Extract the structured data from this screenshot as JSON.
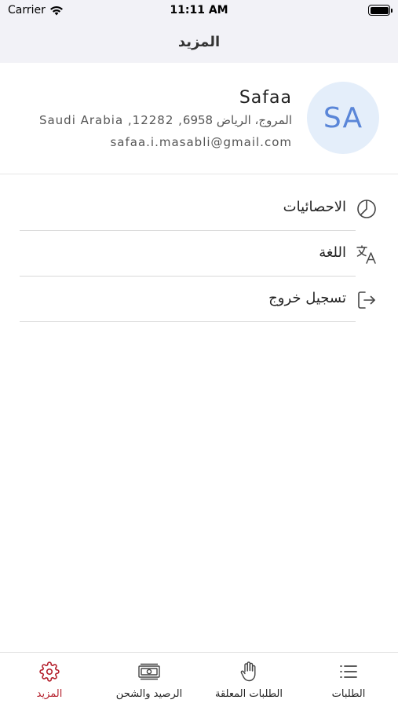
{
  "status_bar": {
    "carrier": "Carrier",
    "time": "11:11 AM"
  },
  "nav": {
    "title": "المزيد"
  },
  "profile": {
    "initials": "SA",
    "name": "Safaa",
    "address": "Saudi Arabia ,12282 ,المروج، الرياض 6958",
    "email": "safaa.i.masabli@gmail.com"
  },
  "menu": {
    "items": [
      {
        "label": "الاحصائيات",
        "icon": "pie-chart-icon"
      },
      {
        "label": "اللغة",
        "icon": "translate-icon"
      },
      {
        "label": "تسجيل خروج",
        "icon": "logout-icon"
      }
    ]
  },
  "tabs": [
    {
      "label": "المزيد",
      "icon": "gear-icon",
      "active": true
    },
    {
      "label": "الرصيد والشحن",
      "icon": "money-icon",
      "active": false
    },
    {
      "label": "الطلبات المعلقة",
      "icon": "hand-icon",
      "active": false
    },
    {
      "label": "الطلبات",
      "icon": "list-icon",
      "active": false
    }
  ],
  "colors": {
    "accent": "#b5222e",
    "avatar_bg": "#e4eefa",
    "avatar_text": "#5a86d8",
    "header_bg": "#f2f2f7"
  }
}
